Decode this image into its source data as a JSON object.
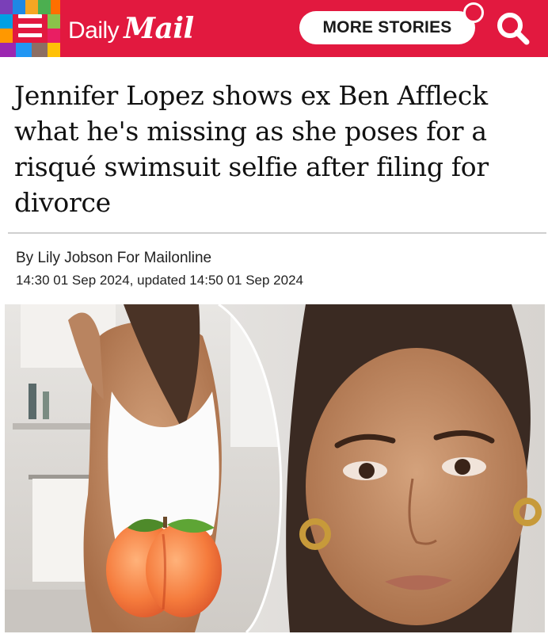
{
  "header": {
    "logo_daily": "Daily",
    "logo_mail": "Mail",
    "more_stories_label": "MORE STORIES",
    "icons": [
      "menu-icon",
      "search-icon",
      "notification-dot"
    ],
    "colors": {
      "brand_red": "#e2193f",
      "text": "#111111",
      "divider": "#cfcfcf"
    }
  },
  "article": {
    "headline": "Jennifer Lopez shows ex Ben Affleck what he's missing as she poses for a risqué swimsuit selfie after filing for divorce",
    "byline": "By Lily Jobson For Mailonline",
    "timestamp": "14:30 01 Sep 2024, updated 14:50 01 Sep 2024",
    "image_overlay_emoji": "peach-emoji"
  }
}
